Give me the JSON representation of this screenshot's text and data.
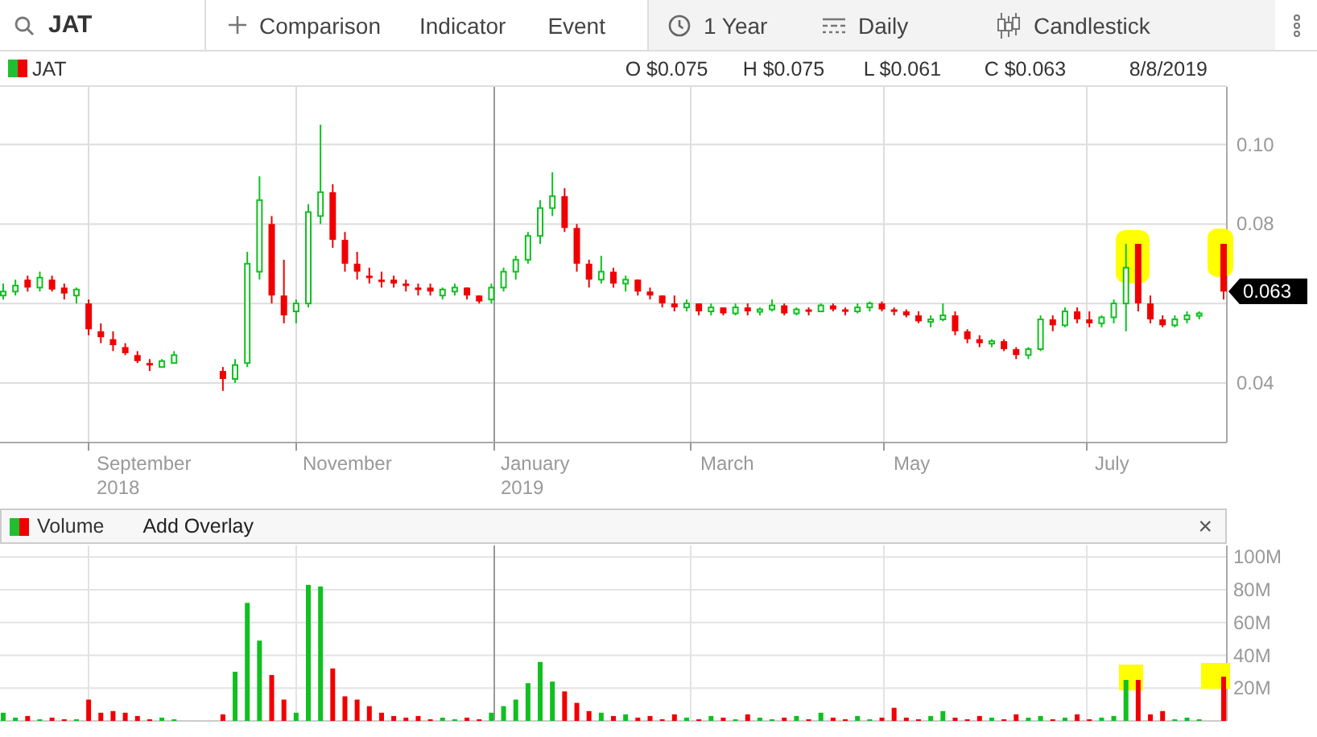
{
  "toolbar": {
    "symbol": "JAT",
    "actions": [
      "Comparison",
      "Indicator",
      "Event"
    ],
    "range": "1 Year",
    "interval": "Daily",
    "chart_type": "Candlestick"
  },
  "legend": {
    "symbol": "JAT",
    "open": "O $0.075",
    "high": "H $0.075",
    "low": "L $0.061",
    "close": "C $0.063",
    "date": "8/8/2019"
  },
  "price_chart": {
    "x_labels": [
      {
        "month": "September",
        "year": "2018"
      },
      {
        "month": "November"
      },
      {
        "month": "January",
        "year": "2019"
      },
      {
        "month": "March"
      },
      {
        "month": "May"
      },
      {
        "month": "July"
      }
    ],
    "last_price": "0.063",
    "chart_data": {
      "type": "candlestick",
      "grid": true,
      "ylim": [
        0.025,
        0.1145
      ],
      "yticks": [
        {
          "value": 0.1,
          "label": "0.10"
        },
        {
          "value": 0.08,
          "label": "0.08"
        },
        {
          "value": 0.04,
          "label": "0.04"
        }
      ],
      "ohlc": [
        [
          0.062,
          0.065,
          0.061,
          0.063
        ],
        [
          0.063,
          0.066,
          0.062,
          0.0645
        ],
        [
          0.066,
          0.067,
          0.063,
          0.064
        ],
        [
          0.064,
          0.068,
          0.063,
          0.0665
        ],
        [
          0.066,
          0.067,
          0.063,
          0.0635
        ],
        [
          0.064,
          0.065,
          0.061,
          0.0625
        ],
        [
          0.062,
          0.064,
          0.06,
          0.0635
        ],
        [
          0.06,
          0.061,
          0.052,
          0.0535
        ],
        [
          0.053,
          0.055,
          0.05,
          0.0515
        ],
        [
          0.051,
          0.053,
          0.048,
          0.0495
        ],
        [
          0.049,
          0.05,
          0.047,
          0.0475
        ],
        [
          0.047,
          0.048,
          0.045,
          0.0455
        ],
        [
          0.045,
          0.046,
          0.043,
          0.0445
        ],
        [
          0.044,
          0.046,
          0.044,
          0.0455
        ],
        [
          0.045,
          0.048,
          0.045,
          0.047
        ],
        null,
        null,
        null,
        [
          0.043,
          0.044,
          0.038,
          0.041
        ],
        [
          0.041,
          0.046,
          0.04,
          0.0445
        ],
        [
          0.045,
          0.073,
          0.044,
          0.07
        ],
        [
          0.068,
          0.092,
          0.066,
          0.086
        ],
        [
          0.08,
          0.082,
          0.06,
          0.062
        ],
        [
          0.062,
          0.071,
          0.055,
          0.057
        ],
        [
          0.058,
          0.061,
          0.055,
          0.06
        ],
        [
          0.06,
          0.085,
          0.059,
          0.083
        ],
        [
          0.082,
          0.105,
          0.08,
          0.088
        ],
        [
          0.088,
          0.09,
          0.074,
          0.076
        ],
        [
          0.076,
          0.078,
          0.068,
          0.07
        ],
        [
          0.07,
          0.073,
          0.066,
          0.068
        ],
        [
          0.067,
          0.069,
          0.065,
          0.0665
        ],
        [
          0.066,
          0.068,
          0.064,
          0.0655
        ],
        [
          0.066,
          0.067,
          0.064,
          0.065
        ],
        [
          0.065,
          0.066,
          0.063,
          0.0645
        ],
        [
          0.064,
          0.065,
          0.062,
          0.0635
        ],
        [
          0.064,
          0.065,
          0.062,
          0.063
        ],
        [
          0.062,
          0.064,
          0.061,
          0.0635
        ],
        [
          0.063,
          0.065,
          0.062,
          0.064
        ],
        [
          0.064,
          0.064,
          0.061,
          0.062
        ],
        [
          0.062,
          0.062,
          0.06,
          0.0605
        ],
        [
          0.061,
          0.065,
          0.06,
          0.064
        ],
        [
          0.064,
          0.069,
          0.063,
          0.068
        ],
        [
          0.068,
          0.072,
          0.066,
          0.071
        ],
        [
          0.071,
          0.078,
          0.07,
          0.077
        ],
        [
          0.077,
          0.086,
          0.075,
          0.084
        ],
        [
          0.084,
          0.093,
          0.082,
          0.087
        ],
        [
          0.087,
          0.089,
          0.078,
          0.079
        ],
        [
          0.079,
          0.08,
          0.068,
          0.07
        ],
        [
          0.07,
          0.071,
          0.064,
          0.066
        ],
        [
          0.066,
          0.072,
          0.065,
          0.068
        ],
        [
          0.068,
          0.069,
          0.064,
          0.065
        ],
        [
          0.065,
          0.067,
          0.063,
          0.066
        ],
        [
          0.066,
          0.066,
          0.062,
          0.063
        ],
        [
          0.063,
          0.064,
          0.061,
          0.062
        ],
        [
          0.062,
          0.062,
          0.059,
          0.06
        ],
        [
          0.06,
          0.062,
          0.058,
          0.059
        ],
        [
          0.059,
          0.061,
          0.058,
          0.06
        ],
        [
          0.06,
          0.06,
          0.057,
          0.058
        ],
        [
          0.058,
          0.06,
          0.057,
          0.059
        ],
        [
          0.059,
          0.059,
          0.057,
          0.0575
        ],
        [
          0.0575,
          0.06,
          0.057,
          0.059
        ],
        [
          0.059,
          0.06,
          0.057,
          0.058
        ],
        [
          0.058,
          0.059,
          0.057,
          0.0585
        ],
        [
          0.0585,
          0.061,
          0.058,
          0.0595
        ],
        [
          0.0595,
          0.06,
          0.057,
          0.0575
        ],
        [
          0.0575,
          0.059,
          0.057,
          0.0585
        ],
        [
          0.0585,
          0.059,
          0.057,
          0.058
        ],
        [
          0.058,
          0.06,
          0.058,
          0.0595
        ],
        [
          0.0595,
          0.06,
          0.058,
          0.0585
        ],
        [
          0.0585,
          0.059,
          0.057,
          0.058
        ],
        [
          0.058,
          0.06,
          0.0575,
          0.059
        ],
        [
          0.059,
          0.0605,
          0.058,
          0.06
        ],
        [
          0.06,
          0.0605,
          0.058,
          0.0585
        ],
        [
          0.0585,
          0.059,
          0.057,
          0.058
        ],
        [
          0.058,
          0.0585,
          0.0565,
          0.057
        ],
        [
          0.057,
          0.058,
          0.055,
          0.0555
        ],
        [
          0.0555,
          0.057,
          0.054,
          0.056
        ],
        [
          0.056,
          0.06,
          0.0555,
          0.057
        ],
        [
          0.057,
          0.058,
          0.052,
          0.053
        ],
        [
          0.053,
          0.0535,
          0.05,
          0.051
        ],
        [
          0.051,
          0.052,
          0.049,
          0.05
        ],
        [
          0.05,
          0.051,
          0.049,
          0.0505
        ],
        [
          0.0505,
          0.051,
          0.048,
          0.0485
        ],
        [
          0.0485,
          0.049,
          0.046,
          0.047
        ],
        [
          0.047,
          0.049,
          0.046,
          0.0485
        ],
        [
          0.0485,
          0.057,
          0.048,
          0.056
        ],
        [
          0.056,
          0.057,
          0.053,
          0.0545
        ],
        [
          0.0545,
          0.059,
          0.054,
          0.058
        ],
        [
          0.058,
          0.059,
          0.055,
          0.056
        ],
        [
          0.056,
          0.058,
          0.054,
          0.055
        ],
        [
          0.055,
          0.057,
          0.054,
          0.0565
        ],
        [
          0.0565,
          0.061,
          0.055,
          0.06
        ],
        [
          0.06,
          0.075,
          0.053,
          0.069
        ],
        [
          0.075,
          0.075,
          0.058,
          0.06
        ],
        [
          0.06,
          0.062,
          0.055,
          0.056
        ],
        [
          0.056,
          0.057,
          0.054,
          0.0545
        ],
        [
          0.0545,
          0.057,
          0.054,
          0.056
        ],
        [
          0.056,
          0.058,
          0.055,
          0.057
        ],
        [
          0.057,
          0.058,
          0.056,
          0.0575
        ],
        null,
        [
          0.075,
          0.075,
          0.061,
          0.063
        ]
      ]
    }
  },
  "volume_panel": {
    "title": "Volume",
    "overlay_button": "Add Overlay",
    "close": "×",
    "chart_data": {
      "type": "bar",
      "grid": true,
      "ylim": [
        0,
        107
      ],
      "yticks": [
        {
          "value": 100,
          "label": "100M"
        },
        {
          "value": 80,
          "label": "80M"
        },
        {
          "value": 60,
          "label": "60M"
        },
        {
          "value": 40,
          "label": "40M"
        },
        {
          "value": 20,
          "label": "20M"
        }
      ],
      "values": [
        5,
        2,
        3,
        1,
        2,
        1,
        1,
        13,
        5,
        6,
        5,
        3,
        1,
        2,
        1,
        null,
        null,
        null,
        4,
        30,
        72,
        49,
        28,
        13,
        5,
        83,
        82,
        32,
        15,
        13,
        9,
        5,
        3,
        2,
        3,
        1,
        2,
        1,
        2,
        1,
        5,
        9,
        13,
        23,
        36,
        24,
        18,
        11,
        6,
        5,
        3,
        4,
        2,
        3,
        1,
        4,
        2,
        1,
        3,
        2,
        1,
        4,
        2,
        1,
        2,
        3,
        1,
        5,
        2,
        1,
        3,
        1,
        2,
        8,
        2,
        1,
        3,
        6,
        2,
        1,
        3,
        2,
        1,
        4,
        2,
        3,
        1,
        2,
        4,
        1,
        2,
        3,
        25,
        25,
        4,
        6,
        1,
        2,
        1,
        null,
        27
      ]
    }
  }
}
